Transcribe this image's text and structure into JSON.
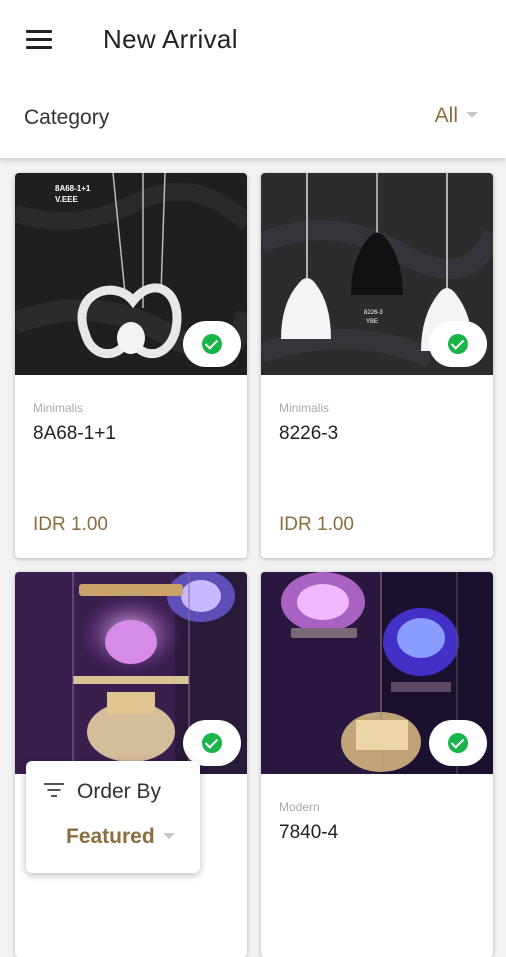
{
  "header": {
    "title": "New Arrival",
    "menu_icon": "hamburger-menu-icon"
  },
  "category": {
    "label": "Category",
    "selected": "All"
  },
  "products": [
    {
      "category": "Minimalis",
      "name": "8A68-1+1",
      "price": "IDR 1.00",
      "image_label_line1": "8A68-1+1",
      "image_label_line2": "V.EEE",
      "selected": true
    },
    {
      "category": "Minimalis",
      "name": "8226-3",
      "price": "IDR 1.00",
      "image_label_line1": "8226-3",
      "image_label_line2": "YBE",
      "selected": true
    },
    {
      "category": "",
      "name": "",
      "price": "",
      "selected": true
    },
    {
      "category": "Modern",
      "name": "7840-4",
      "price": "",
      "selected": true
    }
  ],
  "order": {
    "label": "Order By",
    "selected": "Featured"
  },
  "colors": {
    "accent": "#8c6d3f",
    "check": "#19b44a"
  }
}
